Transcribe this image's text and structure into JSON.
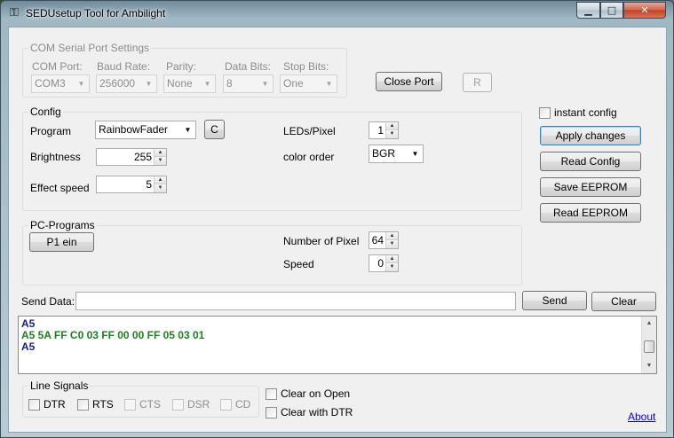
{
  "window": {
    "title": "SEDUsetup Tool for Ambilight",
    "minimize": "▁",
    "maximize": "□",
    "close": "✕"
  },
  "com": {
    "legend": "COM Serial Port Settings",
    "port_label": "COM Port:",
    "port_value": "COM3",
    "baud_label": "Baud Rate:",
    "baud_value": "256000",
    "parity_label": "Parity:",
    "parity_value": "None",
    "databits_label": "Data Bits:",
    "databits_value": "8",
    "stopbits_label": "Stop Bits:",
    "stopbits_value": "One",
    "close_port_button": "Close Port",
    "r_button": "R"
  },
  "config": {
    "legend": "Config",
    "program_label": "Program",
    "program_value": "RainbowFader",
    "c_button": "C",
    "brightness_label": "Brightness",
    "brightness_value": "255",
    "effect_speed_label": "Effect speed",
    "effect_speed_value": "5",
    "leds_pixel_label": "LEDs/Pixel",
    "leds_pixel_value": "1",
    "color_order_label": "color order",
    "color_order_value": "BGR"
  },
  "side": {
    "instant_config_label": "instant config",
    "apply_changes": "Apply changes",
    "read_config": "Read Config",
    "save_eeprom": "Save EEPROM",
    "read_eeprom": "Read EEPROM"
  },
  "pc": {
    "legend": "PC-Programs",
    "p1_button": "P1 ein",
    "num_pixel_label": "Number of Pixel",
    "num_pixel_value": "64",
    "speed_label": "Speed",
    "speed_value": "0"
  },
  "send": {
    "label": "Send Data:",
    "value": "",
    "send_button": "Send",
    "clear_button": "Clear"
  },
  "output": {
    "lines": [
      {
        "text": "A5",
        "color": "#1a1aa6"
      },
      {
        "text": "A5 5A FF C0 03 FF 00 00 FF 05 03 01",
        "color": "#1d7f1d"
      },
      {
        "text": "A5",
        "color": "#1a1aa6"
      }
    ]
  },
  "signals": {
    "legend": "Line Signals",
    "dtr": "DTR",
    "rts": "RTS",
    "cts": "CTS",
    "dsr": "DSR",
    "cd": "CD",
    "clear_on_open": "Clear on Open",
    "clear_with_dtr": "Clear with DTR",
    "about": "About"
  },
  "icons": {
    "app": "app-icon",
    "combo_arrow": "▼",
    "spin_up": "▲",
    "spin_down": "▼"
  }
}
